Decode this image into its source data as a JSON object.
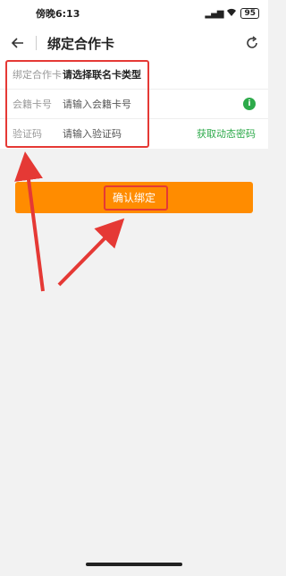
{
  "status_bar": {
    "time": "傍晚6:13",
    "battery": "95"
  },
  "header": {
    "title": "绑定合作卡"
  },
  "form": {
    "rows": [
      {
        "label": "绑定合作卡",
        "value": "请选择联名卡类型"
      },
      {
        "label": "会籍卡号",
        "value": "请输入会籍卡号"
      },
      {
        "label": "验证码",
        "value": "请输入验证码"
      }
    ],
    "get_code_link": "获取动态密码"
  },
  "confirm_button": {
    "label": "确认绑定"
  },
  "colors": {
    "accent_orange": "#ff8c00",
    "green": "#2daa4a",
    "annotation_red": "#e53935"
  }
}
